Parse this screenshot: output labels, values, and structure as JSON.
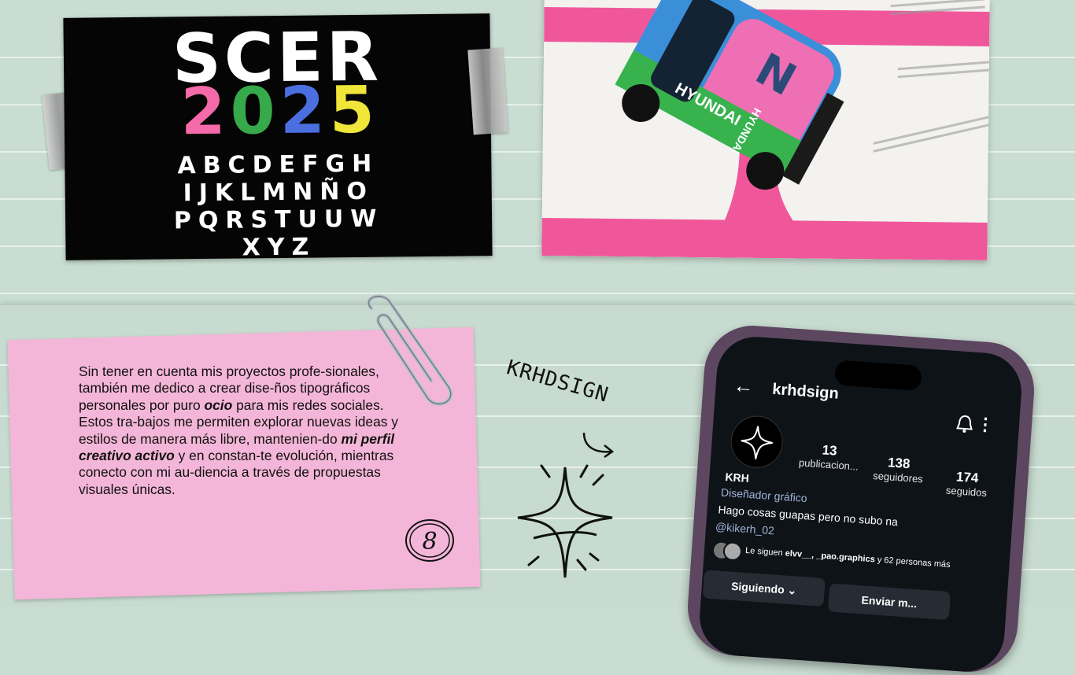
{
  "poster": {
    "title": "SCER",
    "year_digits": [
      "2",
      "0",
      "2",
      "5"
    ],
    "year_colors": [
      "#f56aa8",
      "#36a94b",
      "#4b6fe0",
      "#f0e63a"
    ],
    "alphabet": [
      "ABCDEFGH",
      "IJKLMNÑO",
      "PQRSTUUW",
      "XYZ"
    ]
  },
  "car": {
    "brand": "HYUNDAI",
    "number": "N",
    "sponsor": "HYUNDAI",
    "colors": {
      "body": "#3b8fd9",
      "roof": "#ef6fb4",
      "accent": "#37b24d",
      "stripe": "#f0579b"
    }
  },
  "note": {
    "text_before_ocio": "Sin tener en cuenta mis proyectos profe-sionales, también me dedico a crear dise-ños tipográficos personales por puro ",
    "emph1": "ocio",
    "text_middle": " para mis redes sociales. Estos tra-bajos me permiten explorar nuevas ideas y estilos de manera más libre, mantenien-do ",
    "emph2": "mi perfil creativo activo",
    "text_end": " y en constan-te evolución, mientras conecto con mi au-diencia a través de propuestas visuales únicas.",
    "badge": "8"
  },
  "signature": "KRHDSIGN",
  "profile": {
    "back_icon": "arrow-left-icon",
    "username": "krhdsign",
    "posts_count": "13",
    "posts_label": "publicacion...",
    "followers_count": "138",
    "followers_label": "seguidores",
    "following_count": "174",
    "following_label": "seguidos",
    "display_name": "KRH",
    "category": "Diseñador gráfico",
    "bio": "Hago cosas guapas pero no subo na",
    "handle": "@kikerh_02",
    "followed_by_prefix": "Le siguen",
    "followed_by_names": "elvv__, _pao.graphics",
    "followed_by_suffix": "y 62 personas más",
    "following_button": "Siguiendo",
    "message_button": "Enviar m..."
  }
}
